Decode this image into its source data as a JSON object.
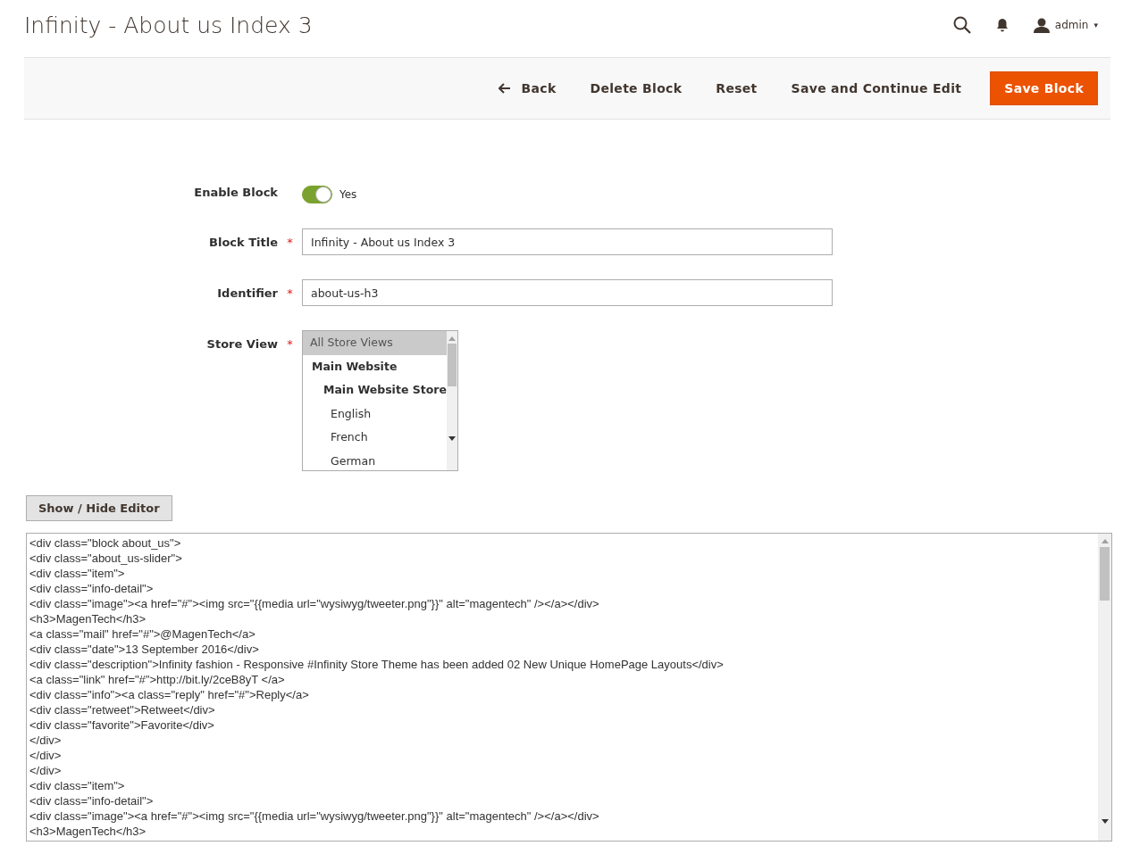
{
  "header": {
    "title": "Infinity - About us Index 3",
    "user": "admin",
    "user_caret": "▾"
  },
  "toolbar": {
    "back": "Back",
    "buttons": [
      {
        "label": "Delete Block",
        "kind": "plain"
      },
      {
        "label": "Reset",
        "kind": "plain"
      },
      {
        "label": "Save and Continue Edit",
        "kind": "plain"
      },
      {
        "label": "Save Block",
        "kind": "primary"
      }
    ]
  },
  "enable_block": {
    "label": "Enable Block",
    "on": true,
    "value": "Yes"
  },
  "fields": [
    {
      "label": "Block Title",
      "required_mark": "*",
      "value": "Infinity - About us Index 3"
    },
    {
      "label": "Identifier",
      "required_mark": "*",
      "value": "about-us-h3"
    }
  ],
  "store_view": {
    "label": "Store View",
    "required_mark": "*",
    "options": [
      {
        "label": "All Store Views",
        "kind": "all",
        "selected": true
      },
      {
        "label": "Main Website",
        "kind": "website",
        "selected": false
      },
      {
        "label": "Main Website Store",
        "kind": "store",
        "selected": false
      },
      {
        "label": "English",
        "kind": "view",
        "selected": false
      },
      {
        "label": "French",
        "kind": "view",
        "selected": false
      },
      {
        "label": "German",
        "kind": "view",
        "selected": false
      }
    ]
  },
  "editor_toggle": "Show / Hide Editor",
  "content_lines": [
    "<div class=\"block about_us\">",
    "<div class=\"about_us-slider\">",
    "<div class=\"item\">",
    "<div class=\"info-detail\">",
    "<div class=\"image\"><a href=\"#\"><img src=\"{{media url=\"wysiwyg/tweeter.png\"}}\" alt=\"magentech\" /></a></div>",
    "<h3>MagenTech</h3>",
    "<a class=\"mail\" href=\"#\">@MagenTech</a>",
    "<div class=\"date\">13 September 2016</div>",
    "<div class=\"description\">Infinity fashion - Responsive #Infinity Store Theme has been added 02 New Unique HomePage Layouts</div>",
    "<a class=\"link\" href=\"#\">http://bit.ly/2ceB8yT </a>",
    "<div class=\"info\"><a class=\"reply\" href=\"#\">Reply</a>",
    "<div class=\"retweet\">Retweet</div>",
    "<div class=\"favorite\">Favorite</div>",
    "</div>",
    "</div>",
    "</div>",
    "<div class=\"item\">",
    "<div class=\"info-detail\">",
    "<div class=\"image\"><a href=\"#\"><img src=\"{{media url=\"wysiwyg/tweeter.png\"}}\" alt=\"magentech\" /></a></div>",
    "<h3>MagenTech</h3>"
  ]
}
